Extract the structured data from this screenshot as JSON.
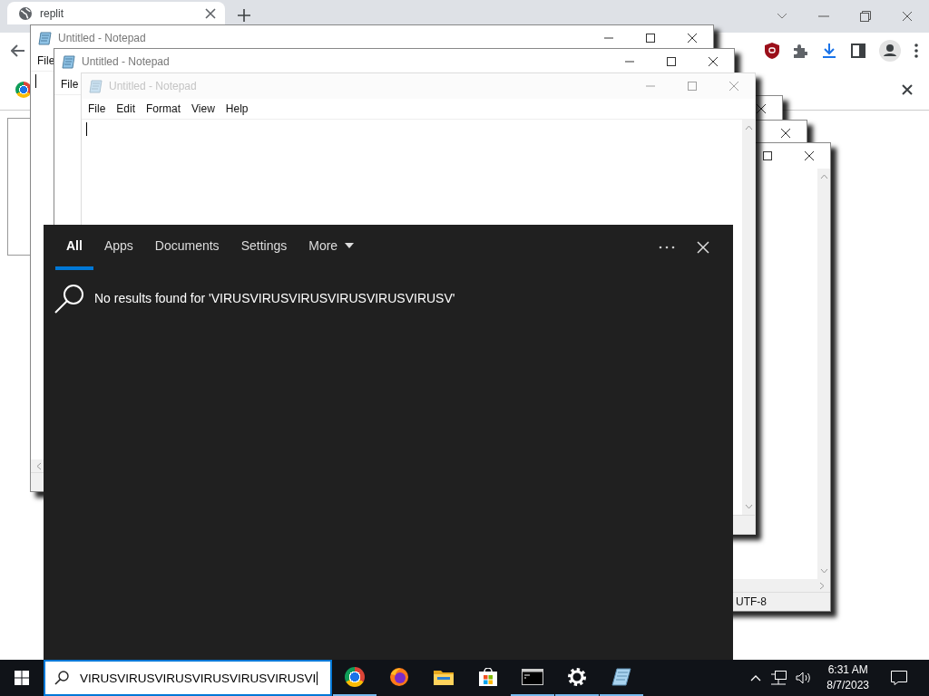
{
  "browser": {
    "tab": {
      "title": "replit"
    }
  },
  "notepad_windows": [
    {
      "kind": "full",
      "title": "Untitled - Notepad",
      "faded": false,
      "menu": [
        "File"
      ]
    },
    {
      "kind": "full",
      "title": "Untitled - Notepad",
      "faded": false,
      "menu": [
        "File"
      ]
    },
    {
      "kind": "edge"
    },
    {
      "kind": "edge"
    },
    {
      "kind": "edge",
      "status": "UTF-8"
    },
    {
      "kind": "full",
      "title": "Untitled - Notepad",
      "faded": true,
      "menu": [
        "File",
        "Edit",
        "Format",
        "View",
        "Help"
      ]
    }
  ],
  "search_panel": {
    "tabs": [
      {
        "label": "All",
        "selected": true,
        "dropdown": false
      },
      {
        "label": "Apps",
        "selected": false,
        "dropdown": false
      },
      {
        "label": "Documents",
        "selected": false,
        "dropdown": false
      },
      {
        "label": "Settings",
        "selected": false,
        "dropdown": false
      },
      {
        "label": "More",
        "selected": false,
        "dropdown": true
      }
    ],
    "message": "No results found for 'VIRUSVIRUSVIRUSVIRUSVIRUSVIRUSV'"
  },
  "taskbar": {
    "search_value": "VIRUSVIRUSVIRUSVIRUSVIRUSVIRUSVI",
    "apps": [
      {
        "kind": "chrome",
        "running": true
      },
      {
        "kind": "firefox",
        "running": false
      },
      {
        "kind": "explorer",
        "running": false
      },
      {
        "kind": "store",
        "running": false
      },
      {
        "kind": "terminal",
        "running": true
      },
      {
        "kind": "settings",
        "running": true
      },
      {
        "kind": "notepad",
        "running": true
      }
    ],
    "time": "6:31 AM",
    "date": "8/7/2023"
  }
}
